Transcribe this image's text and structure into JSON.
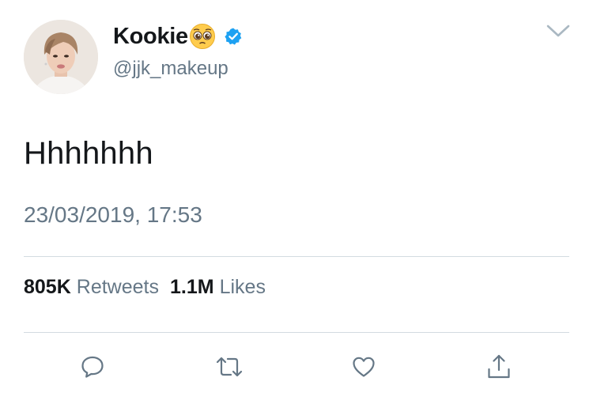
{
  "tweet": {
    "author": {
      "display_name": "Kookie",
      "name_emoji": "pleading-face-emoji",
      "verified": true,
      "handle": "@jjk_makeup",
      "avatar": "profile-photo"
    },
    "text": "Hhhhhhh",
    "timestamp": "23/03/2019, 17:53",
    "stats": {
      "retweets_count": "805K",
      "retweets_label": "Retweets",
      "likes_count": "1.1M",
      "likes_label": "Likes"
    },
    "actions": [
      {
        "name": "reply",
        "icon": "reply-icon"
      },
      {
        "name": "retweet",
        "icon": "retweet-icon"
      },
      {
        "name": "like",
        "icon": "heart-icon"
      },
      {
        "name": "share",
        "icon": "share-icon"
      }
    ],
    "menu_icon": "chevron-down-icon"
  },
  "colors": {
    "text_primary": "#14171a",
    "text_secondary": "#657786",
    "verified_blue": "#1da1f2",
    "divider": "#d3dbe1",
    "icon_gray": "#657786"
  }
}
